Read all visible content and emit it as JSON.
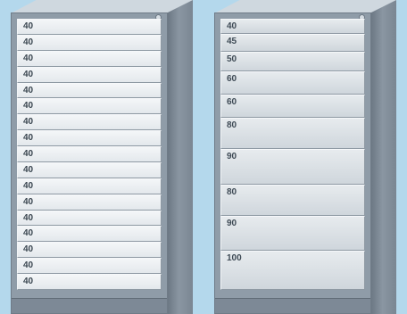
{
  "left_cabinet": {
    "drawers": [
      "40",
      "40",
      "40",
      "40",
      "40",
      "40",
      "40",
      "40",
      "40",
      "40",
      "40",
      "40",
      "40",
      "40",
      "40",
      "40",
      "40"
    ]
  },
  "right_cabinet": {
    "drawers": [
      {
        "label": "40",
        "height": 40
      },
      {
        "label": "45",
        "height": 45
      },
      {
        "label": "50",
        "height": 50
      },
      {
        "label": "60",
        "height": 60
      },
      {
        "label": "60",
        "height": 60
      },
      {
        "label": "80",
        "height": 80
      },
      {
        "label": "90",
        "height": 90
      },
      {
        "label": "80",
        "height": 80
      },
      {
        "label": "90",
        "height": 90
      },
      {
        "label": "100",
        "height": 100
      }
    ]
  },
  "colors": {
    "background": "#b4d8ec",
    "cabinet_body": "#8f9ca8",
    "drawer_face": "#eef1f4"
  }
}
